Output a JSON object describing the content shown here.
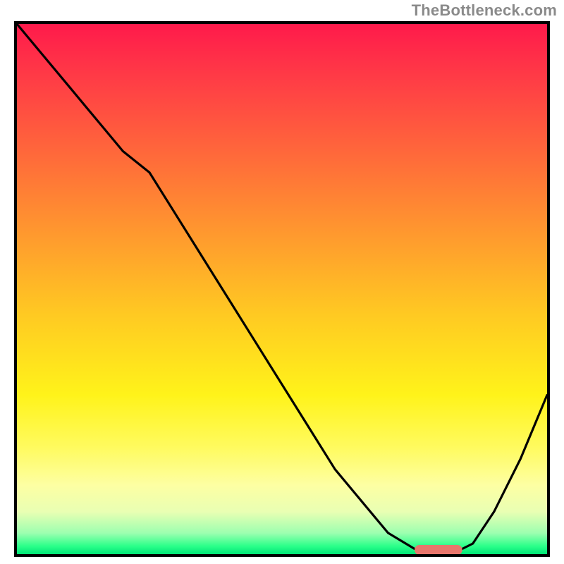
{
  "watermark": "TheBottleneck.com",
  "chart_data": {
    "type": "line",
    "title": "",
    "xlabel": "",
    "ylabel": "",
    "xlim": [
      0,
      100
    ],
    "ylim": [
      0,
      100
    ],
    "gradient_background": {
      "orientation": "vertical",
      "stops": [
        {
          "pos": 0,
          "color": "#ff1a4b"
        },
        {
          "pos": 25,
          "color": "#ff6a3a"
        },
        {
          "pos": 55,
          "color": "#ffca22"
        },
        {
          "pos": 80,
          "color": "#fffb60"
        },
        {
          "pos": 96,
          "color": "#9dffb0"
        },
        {
          "pos": 100,
          "color": "#00e676"
        }
      ]
    },
    "series": [
      {
        "name": "bottleneck-curve",
        "x": [
          0,
          5,
          10,
          15,
          20,
          25,
          30,
          35,
          40,
          45,
          50,
          55,
          60,
          65,
          70,
          75,
          78,
          82,
          86,
          90,
          95,
          100
        ],
        "y": [
          100,
          94,
          88,
          82,
          76,
          72,
          64,
          56,
          48,
          40,
          32,
          24,
          16,
          10,
          4,
          1,
          0,
          0,
          2,
          8,
          18,
          30
        ]
      }
    ],
    "marker": {
      "name": "optimal-range-marker",
      "shape": "rounded-rect",
      "x_start": 75,
      "x_end": 84,
      "y": 0.8,
      "color": "#e8766c"
    }
  }
}
